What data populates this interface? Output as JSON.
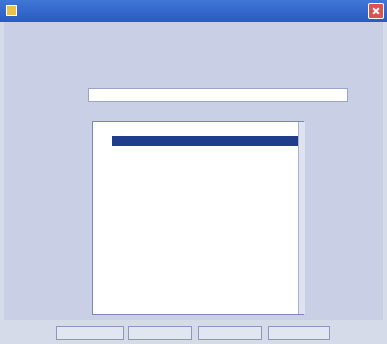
{
  "window": {
    "title": ""
  },
  "heading": "",
  "search": {
    "label": "",
    "value": ""
  },
  "list": {
    "columns": [
      "",
      ""
    ],
    "side_label": "",
    "rows": [
      {
        "code": "",
        "name": "",
        "selected": true
      },
      {
        "code": "",
        "name": ""
      },
      {
        "code": "",
        "name": ""
      },
      {
        "code": "",
        "name": ""
      },
      {
        "code": "",
        "name": ""
      },
      {
        "code": "",
        "name": ""
      },
      {
        "code": "",
        "name": ""
      },
      {
        "code": "",
        "name": ""
      },
      {
        "code": "",
        "name": ""
      },
      {
        "code": "",
        "name": ""
      },
      {
        "code": "",
        "name": ""
      },
      {
        "code": "",
        "name": ""
      },
      {
        "code": "",
        "name": ""
      },
      {
        "code": "",
        "name": ""
      },
      {
        "code": "",
        "name": ""
      },
      {
        "code": "",
        "name": ""
      },
      {
        "code": "",
        "name": ""
      }
    ]
  },
  "buttons": [
    "",
    "",
    "",
    ""
  ]
}
